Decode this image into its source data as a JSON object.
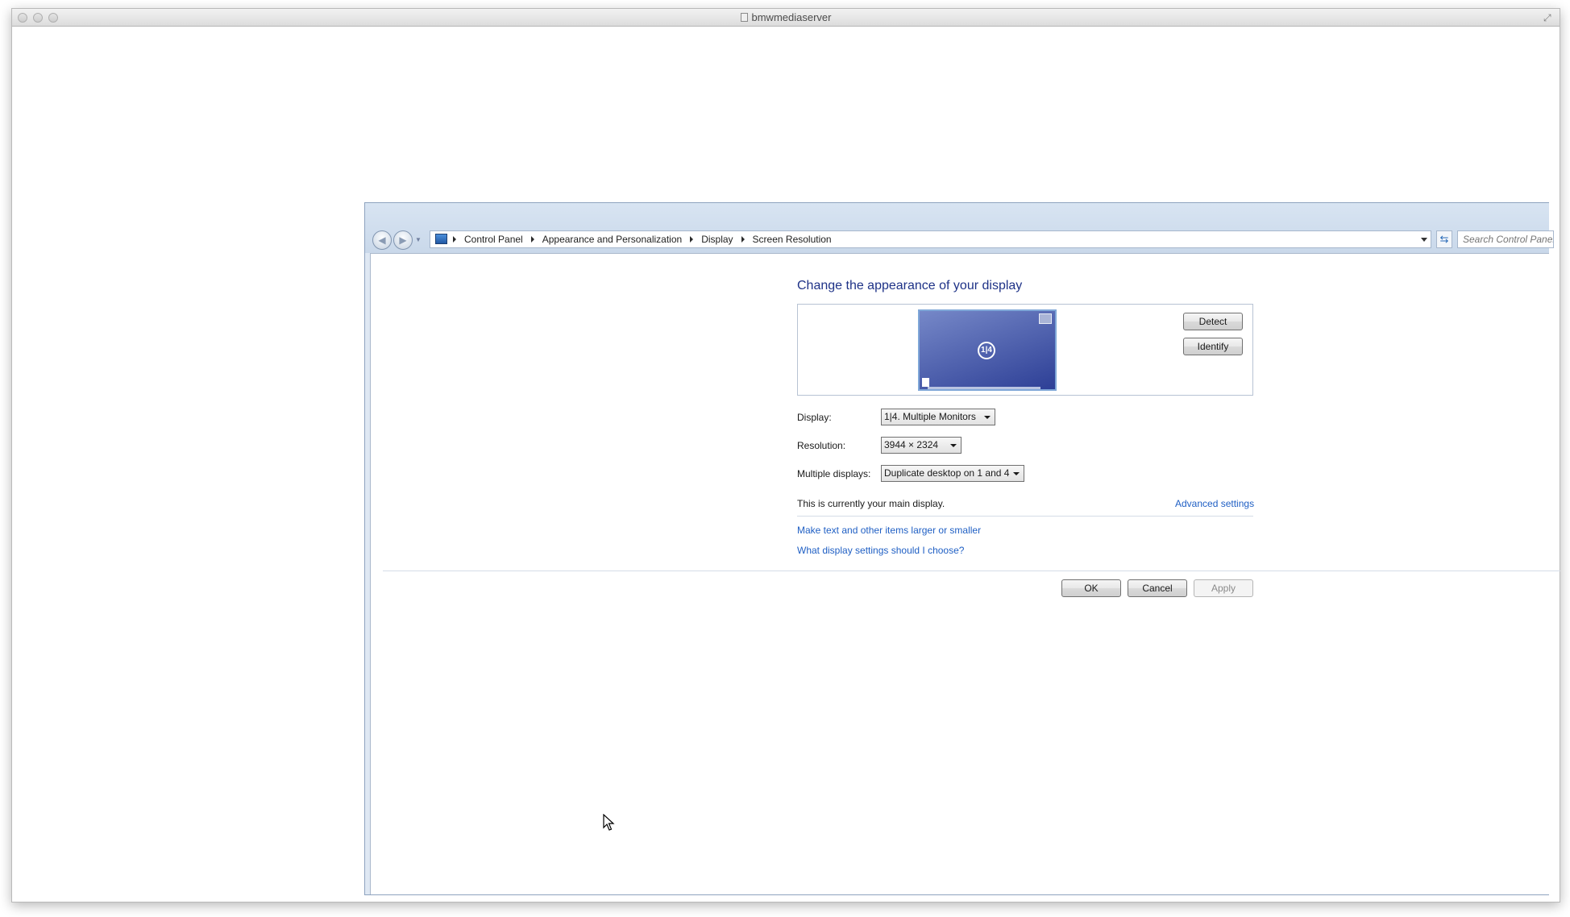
{
  "mac_window": {
    "title": "bmwmediaserver"
  },
  "explorer": {
    "breadcrumbs": [
      "Control Panel",
      "Appearance and Personalization",
      "Display",
      "Screen Resolution"
    ],
    "search_placeholder": "Search Control Panel"
  },
  "page": {
    "heading": "Change the appearance of your display",
    "preview": {
      "monitor_label": "1|4",
      "detect_button": "Detect",
      "identify_button": "Identify"
    },
    "display_label": "Display:",
    "display_value": "1|4. Multiple Monitors",
    "resolution_label": "Resolution:",
    "resolution_value": "3944 × 2324",
    "multiple_displays_label": "Multiple displays:",
    "multiple_displays_value": "Duplicate desktop on 1 and 4",
    "main_display_text": "This is currently your main display.",
    "advanced_settings_link": "Advanced settings",
    "text_size_link": "Make text and other items larger or smaller",
    "help_link": "What display settings should I choose?"
  },
  "footer": {
    "ok_button": "OK",
    "cancel_button": "Cancel",
    "apply_button": "Apply"
  }
}
